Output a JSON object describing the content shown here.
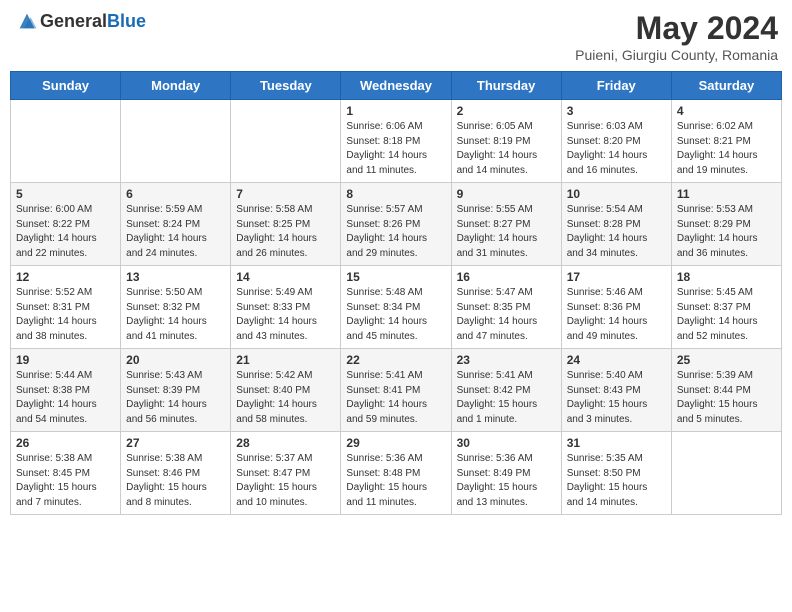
{
  "header": {
    "logo_general": "General",
    "logo_blue": "Blue",
    "title": "May 2024",
    "subtitle": "Puieni, Giurgiu County, Romania"
  },
  "days_of_week": [
    "Sunday",
    "Monday",
    "Tuesday",
    "Wednesday",
    "Thursday",
    "Friday",
    "Saturday"
  ],
  "weeks": [
    [
      {
        "day": "",
        "sunrise": "",
        "sunset": "",
        "daylight": ""
      },
      {
        "day": "",
        "sunrise": "",
        "sunset": "",
        "daylight": ""
      },
      {
        "day": "",
        "sunrise": "",
        "sunset": "",
        "daylight": ""
      },
      {
        "day": "1",
        "sunrise": "Sunrise: 6:06 AM",
        "sunset": "Sunset: 8:18 PM",
        "daylight": "Daylight: 14 hours and 11 minutes."
      },
      {
        "day": "2",
        "sunrise": "Sunrise: 6:05 AM",
        "sunset": "Sunset: 8:19 PM",
        "daylight": "Daylight: 14 hours and 14 minutes."
      },
      {
        "day": "3",
        "sunrise": "Sunrise: 6:03 AM",
        "sunset": "Sunset: 8:20 PM",
        "daylight": "Daylight: 14 hours and 16 minutes."
      },
      {
        "day": "4",
        "sunrise": "Sunrise: 6:02 AM",
        "sunset": "Sunset: 8:21 PM",
        "daylight": "Daylight: 14 hours and 19 minutes."
      }
    ],
    [
      {
        "day": "5",
        "sunrise": "Sunrise: 6:00 AM",
        "sunset": "Sunset: 8:22 PM",
        "daylight": "Daylight: 14 hours and 22 minutes."
      },
      {
        "day": "6",
        "sunrise": "Sunrise: 5:59 AM",
        "sunset": "Sunset: 8:24 PM",
        "daylight": "Daylight: 14 hours and 24 minutes."
      },
      {
        "day": "7",
        "sunrise": "Sunrise: 5:58 AM",
        "sunset": "Sunset: 8:25 PM",
        "daylight": "Daylight: 14 hours and 26 minutes."
      },
      {
        "day": "8",
        "sunrise": "Sunrise: 5:57 AM",
        "sunset": "Sunset: 8:26 PM",
        "daylight": "Daylight: 14 hours and 29 minutes."
      },
      {
        "day": "9",
        "sunrise": "Sunrise: 5:55 AM",
        "sunset": "Sunset: 8:27 PM",
        "daylight": "Daylight: 14 hours and 31 minutes."
      },
      {
        "day": "10",
        "sunrise": "Sunrise: 5:54 AM",
        "sunset": "Sunset: 8:28 PM",
        "daylight": "Daylight: 14 hours and 34 minutes."
      },
      {
        "day": "11",
        "sunrise": "Sunrise: 5:53 AM",
        "sunset": "Sunset: 8:29 PM",
        "daylight": "Daylight: 14 hours and 36 minutes."
      }
    ],
    [
      {
        "day": "12",
        "sunrise": "Sunrise: 5:52 AM",
        "sunset": "Sunset: 8:31 PM",
        "daylight": "Daylight: 14 hours and 38 minutes."
      },
      {
        "day": "13",
        "sunrise": "Sunrise: 5:50 AM",
        "sunset": "Sunset: 8:32 PM",
        "daylight": "Daylight: 14 hours and 41 minutes."
      },
      {
        "day": "14",
        "sunrise": "Sunrise: 5:49 AM",
        "sunset": "Sunset: 8:33 PM",
        "daylight": "Daylight: 14 hours and 43 minutes."
      },
      {
        "day": "15",
        "sunrise": "Sunrise: 5:48 AM",
        "sunset": "Sunset: 8:34 PM",
        "daylight": "Daylight: 14 hours and 45 minutes."
      },
      {
        "day": "16",
        "sunrise": "Sunrise: 5:47 AM",
        "sunset": "Sunset: 8:35 PM",
        "daylight": "Daylight: 14 hours and 47 minutes."
      },
      {
        "day": "17",
        "sunrise": "Sunrise: 5:46 AM",
        "sunset": "Sunset: 8:36 PM",
        "daylight": "Daylight: 14 hours and 49 minutes."
      },
      {
        "day": "18",
        "sunrise": "Sunrise: 5:45 AM",
        "sunset": "Sunset: 8:37 PM",
        "daylight": "Daylight: 14 hours and 52 minutes."
      }
    ],
    [
      {
        "day": "19",
        "sunrise": "Sunrise: 5:44 AM",
        "sunset": "Sunset: 8:38 PM",
        "daylight": "Daylight: 14 hours and 54 minutes."
      },
      {
        "day": "20",
        "sunrise": "Sunrise: 5:43 AM",
        "sunset": "Sunset: 8:39 PM",
        "daylight": "Daylight: 14 hours and 56 minutes."
      },
      {
        "day": "21",
        "sunrise": "Sunrise: 5:42 AM",
        "sunset": "Sunset: 8:40 PM",
        "daylight": "Daylight: 14 hours and 58 minutes."
      },
      {
        "day": "22",
        "sunrise": "Sunrise: 5:41 AM",
        "sunset": "Sunset: 8:41 PM",
        "daylight": "Daylight: 14 hours and 59 minutes."
      },
      {
        "day": "23",
        "sunrise": "Sunrise: 5:41 AM",
        "sunset": "Sunset: 8:42 PM",
        "daylight": "Daylight: 15 hours and 1 minute."
      },
      {
        "day": "24",
        "sunrise": "Sunrise: 5:40 AM",
        "sunset": "Sunset: 8:43 PM",
        "daylight": "Daylight: 15 hours and 3 minutes."
      },
      {
        "day": "25",
        "sunrise": "Sunrise: 5:39 AM",
        "sunset": "Sunset: 8:44 PM",
        "daylight": "Daylight: 15 hours and 5 minutes."
      }
    ],
    [
      {
        "day": "26",
        "sunrise": "Sunrise: 5:38 AM",
        "sunset": "Sunset: 8:45 PM",
        "daylight": "Daylight: 15 hours and 7 minutes."
      },
      {
        "day": "27",
        "sunrise": "Sunrise: 5:38 AM",
        "sunset": "Sunset: 8:46 PM",
        "daylight": "Daylight: 15 hours and 8 minutes."
      },
      {
        "day": "28",
        "sunrise": "Sunrise: 5:37 AM",
        "sunset": "Sunset: 8:47 PM",
        "daylight": "Daylight: 15 hours and 10 minutes."
      },
      {
        "day": "29",
        "sunrise": "Sunrise: 5:36 AM",
        "sunset": "Sunset: 8:48 PM",
        "daylight": "Daylight: 15 hours and 11 minutes."
      },
      {
        "day": "30",
        "sunrise": "Sunrise: 5:36 AM",
        "sunset": "Sunset: 8:49 PM",
        "daylight": "Daylight: 15 hours and 13 minutes."
      },
      {
        "day": "31",
        "sunrise": "Sunrise: 5:35 AM",
        "sunset": "Sunset: 8:50 PM",
        "daylight": "Daylight: 15 hours and 14 minutes."
      },
      {
        "day": "",
        "sunrise": "",
        "sunset": "",
        "daylight": ""
      }
    ]
  ]
}
